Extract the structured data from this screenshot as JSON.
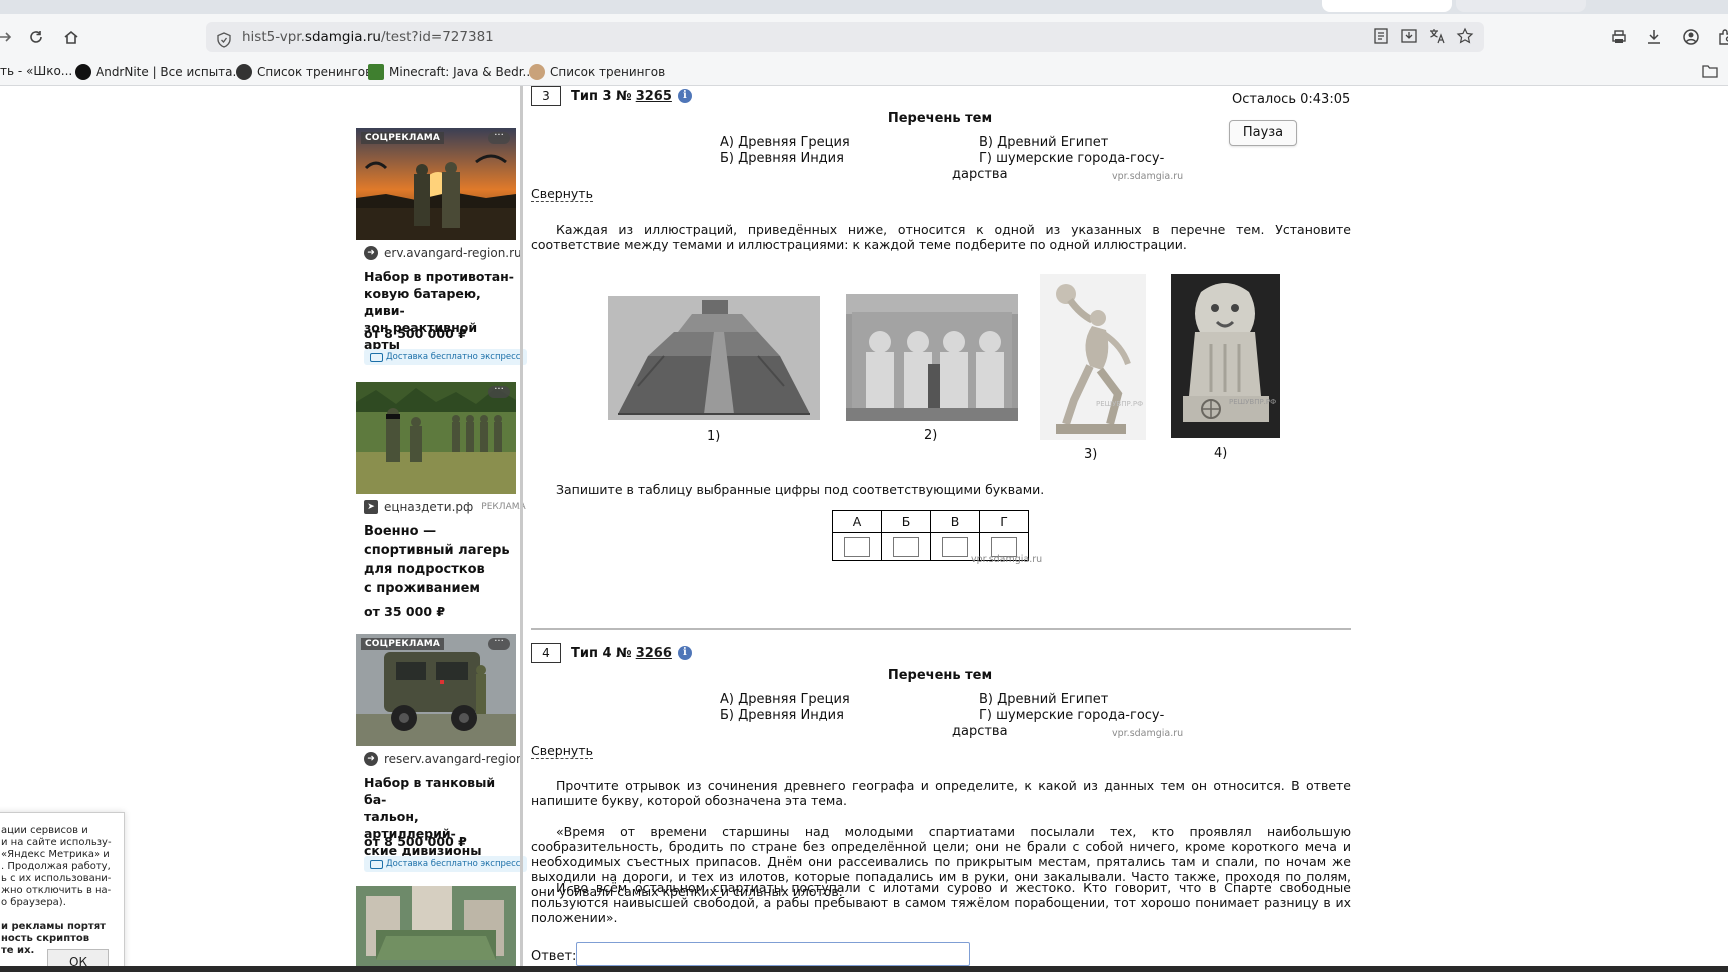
{
  "browser": {
    "url_prefix": "hist5-vpr.",
    "url_host": "sdamgia.ru",
    "url_path": "/test?id=727381"
  },
  "bookmarks": [
    {
      "label": "ть - «Шко..."
    },
    {
      "label": "AndrNite | Все испыта..."
    },
    {
      "label": "Список тренингов"
    },
    {
      "label": "Minecraft: Java & Bedr..."
    },
    {
      "label": "Список тренингов"
    }
  ],
  "ads": [
    {
      "tag": "СОЦРЕКЛАМА",
      "source": "erv.avangard-region.ru",
      "source_label": "",
      "title_lines": [
        "Набор в противотан-",
        "ковую батарею, диви-",
        "зон реактивной арты"
      ],
      "price": "от 8 500 000 ₽",
      "delivery": "Доставка бесплатно экспресс"
    },
    {
      "tag": "",
      "source": "eцназдети.рф",
      "source_label": "РЕКЛАМА",
      "title_lines": [
        "Военно —",
        "спортивный лагерь",
        "для подростков",
        "с проживанием"
      ],
      "price": "от 35 000 ₽",
      "delivery": ""
    },
    {
      "tag": "СОЦРЕКЛАМА",
      "source": "reserv.avangard-region",
      "source_label": "",
      "title_lines": [
        "Набор в танковый ба-",
        "тальон, артиллерий-",
        "ские дивизионы"
      ],
      "price": "от 8 500 000 ₽",
      "delivery": "Доставка бесплатно экспресс"
    }
  ],
  "cookie_notice": {
    "text": "ации сервисов и\nи на сайте использу-\n«Яндекс Метрика» и\n. Продолжая работу,\nь с их использовани-\nжно отключить в на-\nо браузера).",
    "bold_text": "и рекламы портят\nность скриптов\nте их.",
    "ok_label": "ОК"
  },
  "timer": {
    "label": "Осталось 0:43:05"
  },
  "pause_label": "Пауза",
  "task3": {
    "number": "3",
    "title": "Тип 3 №",
    "id_link": "3265",
    "topics_heading": "Перечень тем",
    "topics": {
      "a": "А) Древняя Греция",
      "b": "Б) Древняя Индия",
      "v": "В) Древний Египет",
      "g_line1": "Г) шумерские города-госу-",
      "g_line2": "дарства"
    },
    "watermark": "vpr.sdamgia.ru",
    "collapse_label": "Свернуть",
    "instruction": "Каждая из иллюстраций, приведённых ниже, относится к одной из указанных в перечне тем. Установите соответствие между темами и иллюстрациями: к каждой теме подберите по одной иллюстрации.",
    "illustrations": [
      {
        "caption": "1)",
        "icon": "ziggurat-image"
      },
      {
        "caption": "2)",
        "icon": "abu-simbel-image"
      },
      {
        "caption": "3)",
        "icon": "discobolus-image",
        "watermark": "РЕШУВПР.РФ"
      },
      {
        "caption": "4)",
        "icon": "ashoka-lion-image",
        "watermark": "РЕШУВПР.РФ"
      }
    ],
    "table_instruction": "Запишите в таблицу выбранные цифры под соответствующими буквами.",
    "table_headers": [
      "А",
      "Б",
      "В",
      "Г"
    ],
    "table_watermark": "vpr.sdamgia.ru"
  },
  "task4": {
    "number": "4",
    "title": "Тип 4 №",
    "id_link": "3266",
    "topics_heading": "Перечень тем",
    "topics": {
      "a": "А) Древняя Греция",
      "b": "Б) Древняя Индия",
      "v": "В) Древний Египет",
      "g_line1": "Г) шумерские города-госу-",
      "g_line2": "дарства"
    },
    "watermark": "vpr.sdamgia.ru",
    "collapse_label": "Свернуть",
    "instruction": "Прочтите отрывок из сочинения древнего географа и определите, к какой из данных тем он относится. В ответе напишите букву, которой обозначена эта тема.",
    "quote_p1": "«Время от времени старшины над молодыми спартиатами посылали тех, кто проявлял наибольшую сообразительность, бродить по стране без определённой цели; они не брали с собой ничего, кроме короткого меча и необходимых съестных припасов. Днём они рассеивались по прикрытым местам, прятались там и спали, по ночам же выходили на дороги, и тех из илотов, которые попадались им в руки, они закалывали. Часто также, проходя по полям, они убивали самых крепких и сильных илотов.",
    "quote_p2": "И во всём остальном спартиаты поступали с илотами сурово и жестоко. Кто говорит, что в Спарте свободные пользуются наивысшей свободой, а рабы пребывают в самом тяжёлом порабощении, тот хорошо понимает разницу в их положении».",
    "answer_label": "Ответ:",
    "answer_value": ""
  }
}
